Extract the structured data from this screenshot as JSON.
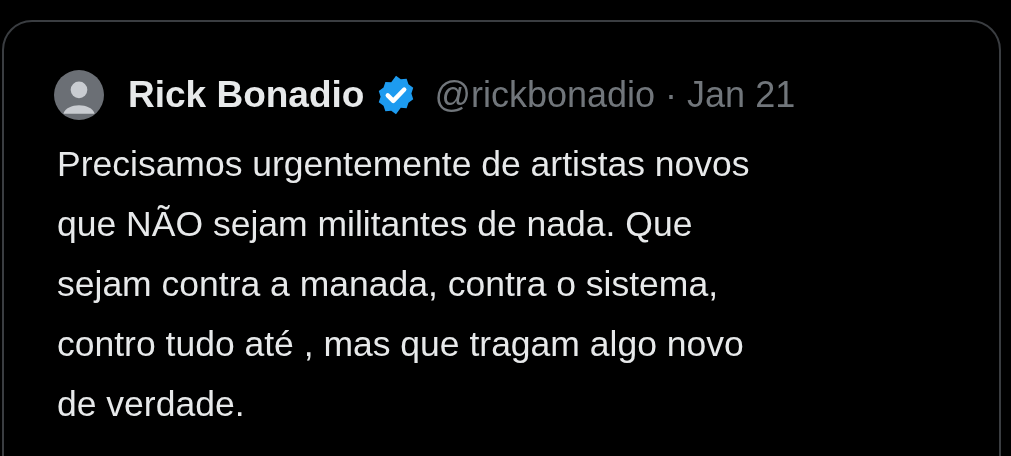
{
  "quoted_tweet": {
    "author": {
      "name": "Rick Bonadio",
      "verified": true,
      "handle": "@rickbonadio",
      "separator": "·",
      "date": "Jan 21"
    },
    "text": "Precisamos urgentemente de artistas novos\nque NÃO sejam militantes de nada. Que\nsejam contra a manada, contra o sistema,\ncontro tudo até , mas que tragam algo novo\nde verdade."
  }
}
